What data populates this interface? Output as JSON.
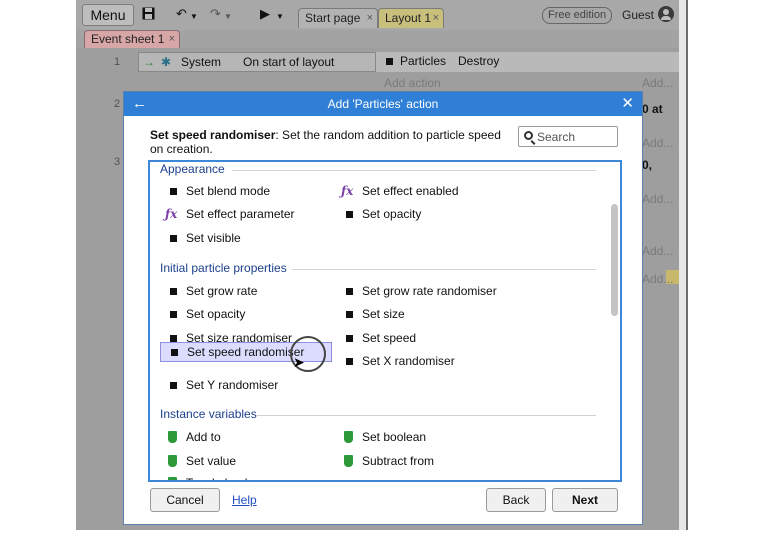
{
  "toolbar": {
    "menu_label": "Menu",
    "tabs": [
      {
        "label": "Start page",
        "close": "×"
      },
      {
        "label": "Layout 1",
        "close": "×"
      }
    ],
    "edition_badge": "Free edition",
    "user_label": "Guest"
  },
  "sheet_tab": {
    "label": "Event sheet 1",
    "close": "×"
  },
  "event_sheet": {
    "row1_number": "1",
    "row2_number": "2",
    "row3_number": "3",
    "condition_object": "System",
    "condition_trigger": "On start of layout",
    "action_object": "Particles",
    "action_name": "Destroy",
    "add_action": "Add action",
    "add_peek": "Add...",
    "row2_peek": "0 at",
    "row3_peek": "0,"
  },
  "dialog": {
    "title": "Add 'Particles' action",
    "description_title": "Set speed randomiser",
    "description_text": ": Set the random addition to particle speed on creation.",
    "search_placeholder": "Search",
    "sections": {
      "appearance": "Appearance",
      "initial_particle": "Initial particle properties",
      "instance_variables": "Instance variables"
    },
    "appearance_items": [
      "Set blend mode",
      "Set effect enabled",
      "Set effect parameter",
      "Set opacity",
      "Set visible"
    ],
    "initial_items": [
      "Set grow rate",
      "Set grow rate randomiser",
      "Set opacity",
      "Set size",
      "Set size randomiser",
      "Set speed",
      "Set speed randomiser",
      "Set X randomiser",
      "Set Y randomiser"
    ],
    "instance_items": [
      "Add to",
      "Set boolean",
      "Set value",
      "Subtract from",
      "Toggle boolean"
    ],
    "buttons": {
      "cancel": "Cancel",
      "help": "Help",
      "back": "Back",
      "next": "Next"
    }
  },
  "colors": {
    "header_blue": "#2f7fd6",
    "section_text": "#1c3f8c",
    "selected_bg": "#dcdcff",
    "fx_purple": "#7b3fa8",
    "variable_green": "#2d9a3a"
  }
}
